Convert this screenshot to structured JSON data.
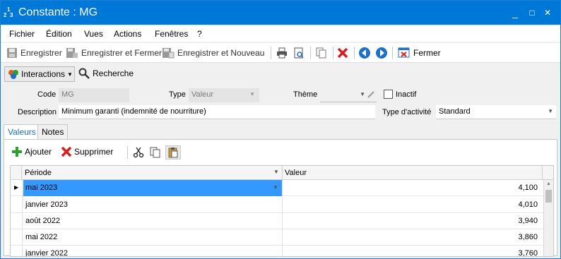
{
  "window": {
    "icon_text": "1 2 3",
    "title": "Constante : MG",
    "controls": {
      "minimize": "_",
      "maximize": "□",
      "close": "✕"
    }
  },
  "menu": [
    "Fichier",
    "Édition",
    "Vues",
    "Actions",
    "Fenêtres",
    "?"
  ],
  "toolbar": {
    "save": "Enregistrer",
    "save_close": "Enregistrer et Fermer",
    "save_new": "Enregistrer et Nouveau",
    "close": "Fermer"
  },
  "toolbar2": {
    "interactions": "Interactions",
    "search": "Recherche"
  },
  "form": {
    "code_label": "Code",
    "code_value": "MG",
    "type_label": "Type",
    "type_value": "Valeur",
    "theme_label": "Thème",
    "theme_value": "",
    "inactive_label": "Inactif",
    "description_label": "Description",
    "description_value": "Minimum garanti (indemnité de nourriture)",
    "activity_label": "Type d'activité",
    "activity_value": "Standard"
  },
  "tabs": [
    "Valeurs",
    "Notes"
  ],
  "grid_toolbar": {
    "add": "Ajouter",
    "delete": "Supprimer"
  },
  "grid": {
    "columns": [
      "Période",
      "Valeur"
    ],
    "rows": [
      {
        "period": "mai 2023",
        "value": "4,100"
      },
      {
        "period": "janvier 2023",
        "value": "4,010"
      },
      {
        "period": "août 2022",
        "value": "3,940"
      },
      {
        "period": "mai 2022",
        "value": "3,860"
      },
      {
        "period": "janvier 2022",
        "value": "3,760"
      }
    ]
  },
  "colors": {
    "titlebar": "#0078d7",
    "selection": "#3399ff",
    "delete_red": "#d42020",
    "add_green": "#2e9e2e",
    "nav_blue": "#1e6fc8"
  }
}
